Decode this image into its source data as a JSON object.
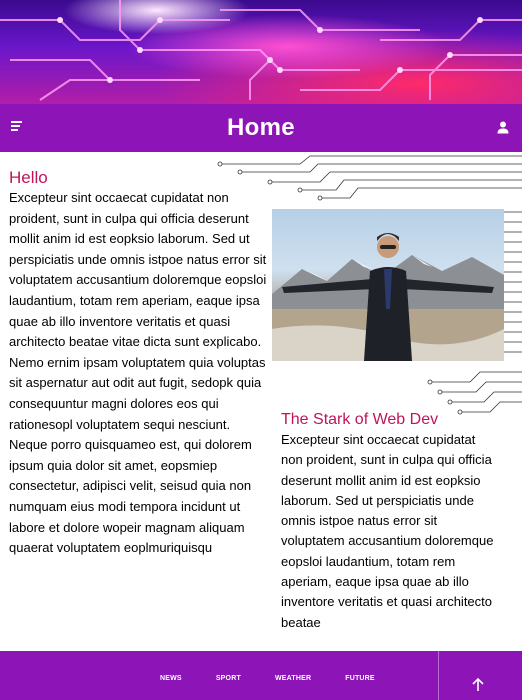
{
  "header": {
    "title": "Home",
    "menu_icon": "menu-icon",
    "user_icon": "user-icon"
  },
  "main": {
    "heading": "Hello",
    "paragraph": "Excepteur sint occaecat cupidatat non proident, sunt in culpa qui officia deserunt mollit anim id est eopksio laborum. Sed ut perspiciatis unde omnis istpoe natus error sit voluptatem accusantium doloremque eopsloi laudantium, totam rem aperiam, eaque ipsa quae ab illo inventore veritatis et quasi architecto beatae vitae dicta sunt explicabo. Nemo ernim ipsam voluptatem quia voluptas sit aspernatur aut odit aut fugit, sedopk quia consequuntur magni dolores eos qui rationesopl voluptatem sequi nesciunt. Neque porro quisquameo est, qui dolorem ipsum quia dolor sit amet, eopsmiep consectetur, adipisci velit, seisud quia non numquam eius modi tempora incidunt ut labore et dolore wopeir magnam aliquam quaerat voluptatem eoplmuriquisqu"
  },
  "feature": {
    "heading": "The Stark of Web Dev",
    "paragraph": "Excepteur sint occaecat cupidatat non proident, sunt in culpa qui officia deserunt mollit anim id est eopksio laborum. Sed ut perspiciatis unde omnis istpoe natus error sit voluptatem accusantium doloremque eopsloi laudantium, totam rem aperiam, eaque ipsa quae ab illo inventore veritatis et quasi architecto beatae"
  },
  "footer": {
    "links": [
      "NEWS",
      "SPORT",
      "WEATHER",
      "FUTURE"
    ],
    "up_icon": "arrow-up-icon"
  },
  "colors": {
    "brand": "#8d14b6",
    "heading_accent": "#c0155c"
  }
}
